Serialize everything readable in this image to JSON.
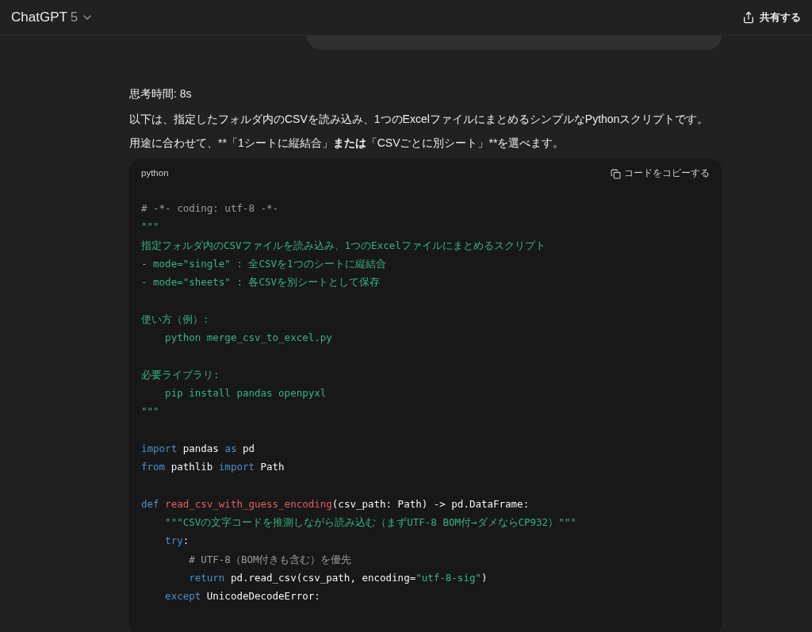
{
  "header": {
    "title": "ChatGPT",
    "model": "5",
    "share_label": "共有する"
  },
  "thinking": "思考時間: 8s",
  "paragraphs": [
    [
      {
        "text": "以下は、指定したフォルダ内のCSVを読み込み、1つのExcelファイルにまとめるシンプルなPythonスクリプトです。",
        "bold": false
      }
    ],
    [
      {
        "text": "用途に合わせて、**「1シートに縦結合」",
        "bold": false
      },
      {
        "text": "または",
        "bold": true
      },
      {
        "text": "「CSVごとに別シート」**を選べます。",
        "bold": false
      }
    ]
  ],
  "code_block": {
    "language": "python",
    "copy_label": "コードをコピーする",
    "lines": [
      {
        "kind": "code",
        "tokens": [
          {
            "kind": "comment",
            "text": "# -*- coding: utf-8 -*-"
          }
        ]
      },
      {
        "kind": "code",
        "tokens": [
          {
            "kind": "string",
            "text": "\"\"\""
          }
        ]
      },
      {
        "kind": "code",
        "tokens": [
          {
            "kind": "string",
            "text": "指定フォルダ内のCSVファイルを読み込み、1つのExcelファイルにまとめるスクリプト"
          }
        ]
      },
      {
        "kind": "code",
        "tokens": [
          {
            "kind": "string",
            "text": "- mode=\"single\" : 全CSVを1つのシートに縦結合"
          }
        ]
      },
      {
        "kind": "code",
        "tokens": [
          {
            "kind": "string",
            "text": "- mode=\"sheets\" : 各CSVを別シートとして保存"
          }
        ]
      },
      {
        "kind": "blank"
      },
      {
        "kind": "code",
        "tokens": [
          {
            "kind": "string",
            "text": "使い方（例）:"
          }
        ]
      },
      {
        "kind": "code",
        "tokens": [
          {
            "kind": "string",
            "text": "    python merge_csv_to_excel.py"
          }
        ]
      },
      {
        "kind": "blank"
      },
      {
        "kind": "code",
        "tokens": [
          {
            "kind": "string",
            "text": "必要ライブラリ:"
          }
        ]
      },
      {
        "kind": "code",
        "tokens": [
          {
            "kind": "string",
            "text": "    pip install pandas openpyxl"
          }
        ]
      },
      {
        "kind": "code",
        "tokens": [
          {
            "kind": "string",
            "text": "\"\"\""
          }
        ]
      },
      {
        "kind": "blank"
      },
      {
        "kind": "code",
        "tokens": [
          {
            "kind": "keyword",
            "text": "import"
          },
          {
            "kind": "plain",
            "text": " pandas "
          },
          {
            "kind": "keyword",
            "text": "as"
          },
          {
            "kind": "plain",
            "text": " pd"
          }
        ]
      },
      {
        "kind": "code",
        "tokens": [
          {
            "kind": "keyword",
            "text": "from"
          },
          {
            "kind": "plain",
            "text": " pathlib "
          },
          {
            "kind": "keyword",
            "text": "import"
          },
          {
            "kind": "plain",
            "text": " Path"
          }
        ]
      },
      {
        "kind": "blank"
      },
      {
        "kind": "code",
        "tokens": [
          {
            "kind": "keyword",
            "text": "def "
          },
          {
            "kind": "function",
            "text": "read_csv_with_guess_encoding"
          },
          {
            "kind": "plain",
            "text": "(csv_path: Path) -> pd.DataFrame:"
          }
        ]
      },
      {
        "kind": "code",
        "tokens": [
          {
            "kind": "string",
            "text": "    \"\"\"CSVの文字コードを推測しながら読み込む（まずUTF-8 BOM付→ダメならCP932）\"\"\""
          }
        ]
      },
      {
        "kind": "code",
        "tokens": [
          {
            "kind": "keyword",
            "text": "    try"
          },
          {
            "kind": "plain",
            "text": ":"
          }
        ]
      },
      {
        "kind": "code",
        "tokens": [
          {
            "kind": "comment",
            "text": "        # UTF-8（BOM付きも含む）を優先"
          }
        ]
      },
      {
        "kind": "code",
        "tokens": [
          {
            "kind": "keyword",
            "text": "        return"
          },
          {
            "kind": "plain",
            "text": " pd.read_csv(csv_path, encoding="
          },
          {
            "kind": "string",
            "text": "\"utf-8-sig\""
          },
          {
            "kind": "plain",
            "text": ")"
          }
        ]
      },
      {
        "kind": "code",
        "tokens": [
          {
            "kind": "keyword",
            "text": "    except"
          },
          {
            "kind": "plain",
            "text": " UnicodeDecodeError:"
          }
        ]
      }
    ]
  }
}
